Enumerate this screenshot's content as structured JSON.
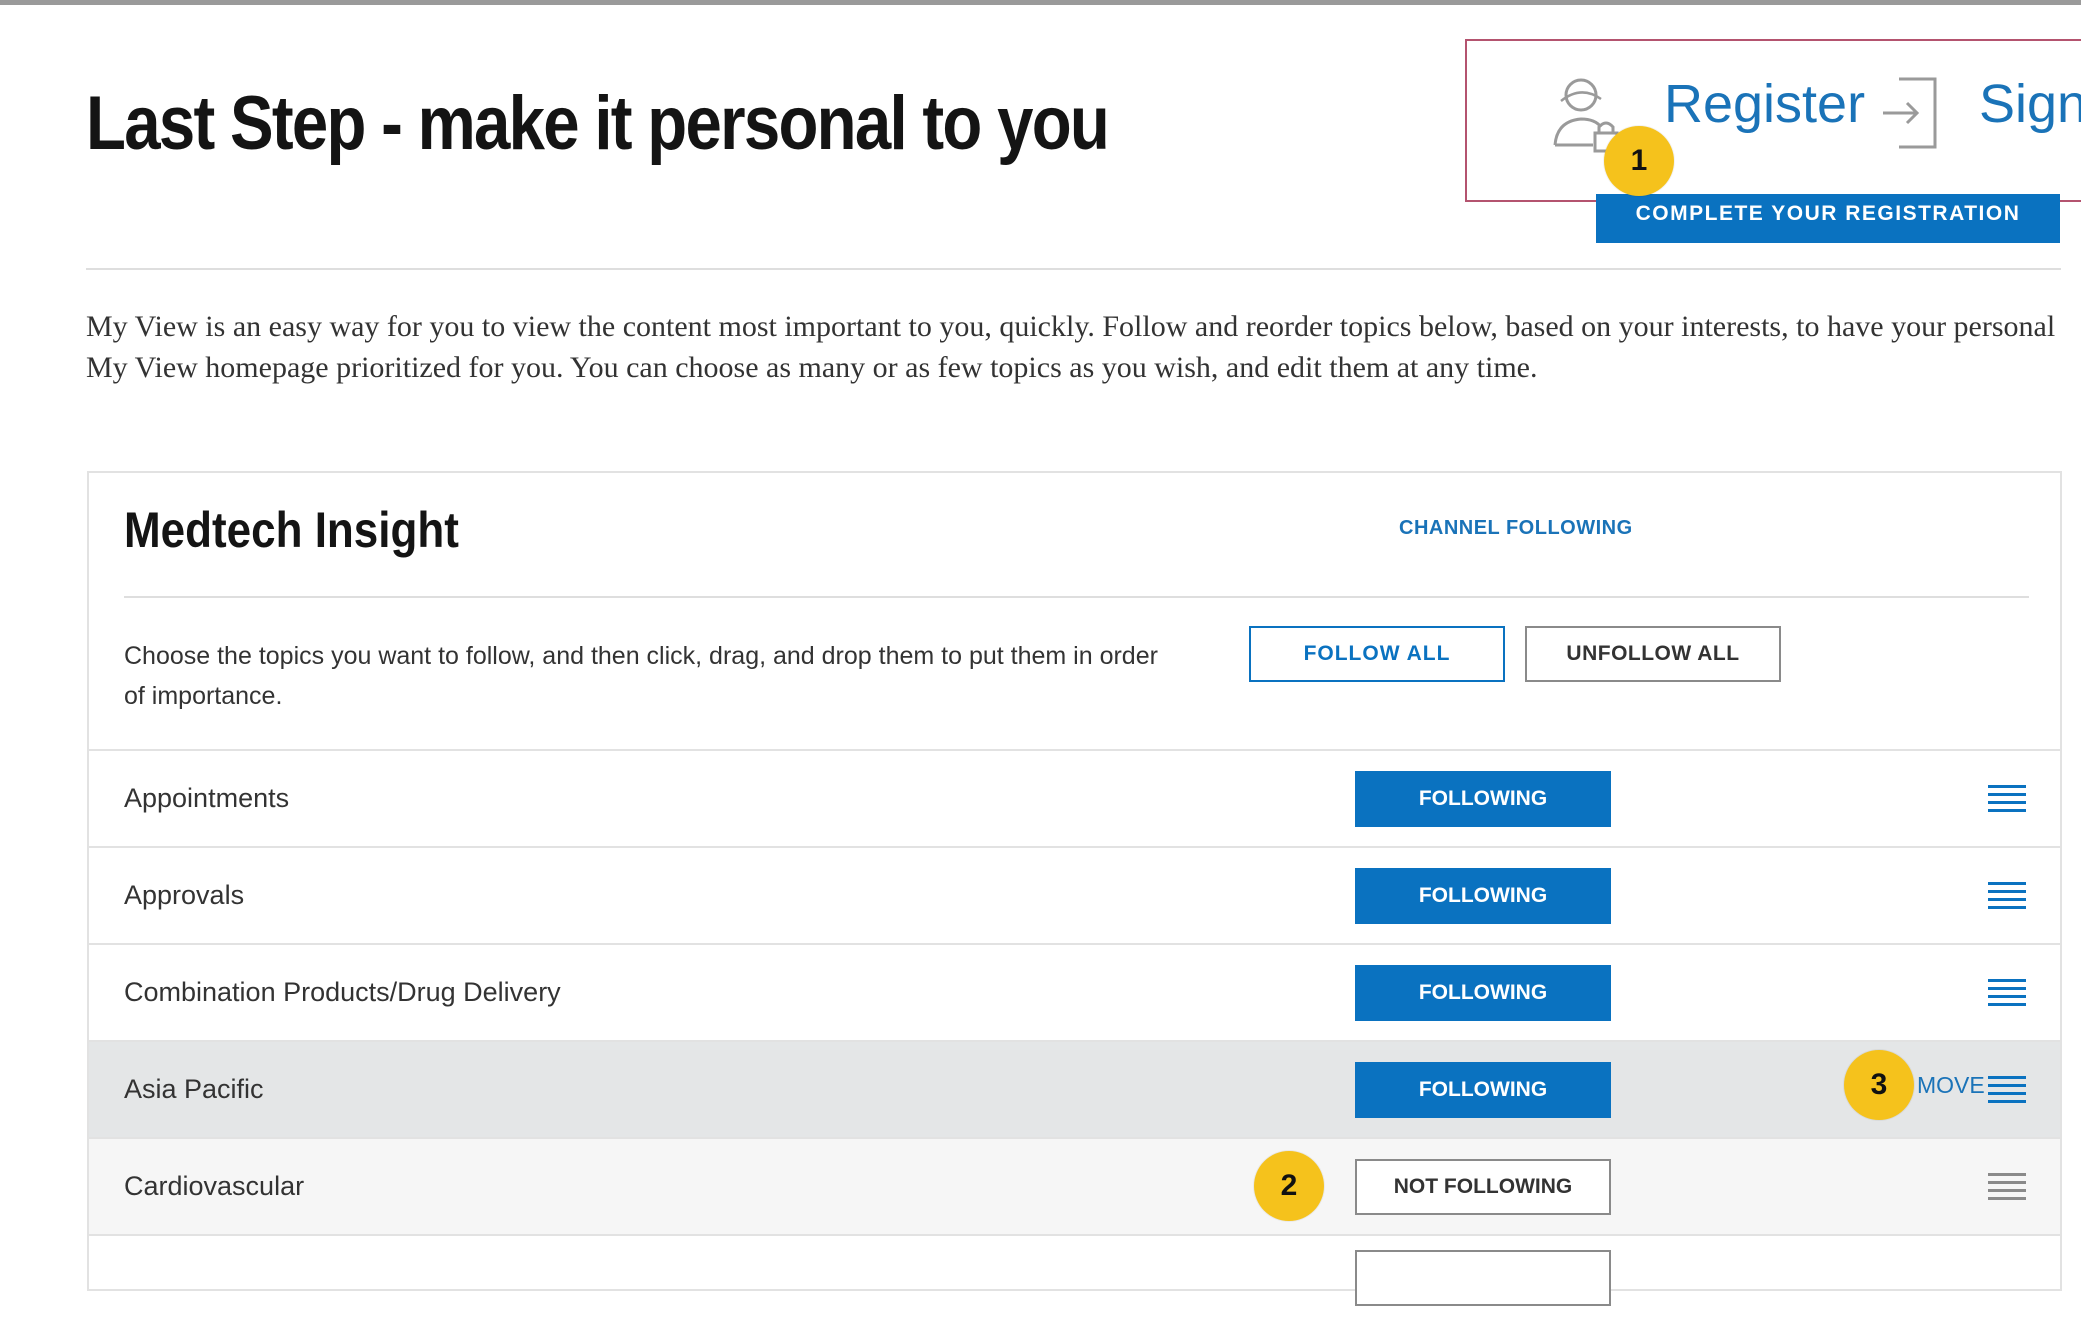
{
  "header": {
    "title": "Last Step - make it personal to you",
    "register_label": "Register",
    "signin_label": "Sign",
    "complete_registration_label": "COMPLETE YOUR REGISTRATION"
  },
  "intro_text": "My View is an easy way for you to view the content most important to you, quickly. Follow and reorder topics below, based on your interests, to have your personal My View homepage prioritized for you. You can choose as many or as few topics as you wish, and edit them at any time.",
  "channel": {
    "title": "Medtech Insight",
    "status_label": "CHANNEL FOLLOWING",
    "instructions": "Choose the topics you want to follow, and then click, drag, and drop them to put them in order of importance.",
    "follow_all_label": "FOLLOW ALL",
    "unfollow_all_label": "UNFOLLOW ALL"
  },
  "topics": [
    {
      "label": "Appointments",
      "status": "FOLLOWING"
    },
    {
      "label": "Approvals",
      "status": "FOLLOWING"
    },
    {
      "label": "Combination Products/Drug Delivery",
      "status": "FOLLOWING"
    },
    {
      "label": "Asia Pacific",
      "status": "FOLLOWING",
      "move_label": "MOVE"
    },
    {
      "label": "Cardiovascular",
      "status": "NOT FOLLOWING"
    }
  ],
  "badges": [
    "1",
    "2",
    "3"
  ],
  "colors": {
    "accent": "#0a72c0",
    "link": "#1a73b8",
    "badge": "#f5c21c",
    "highlight_border": "#b4536f"
  }
}
